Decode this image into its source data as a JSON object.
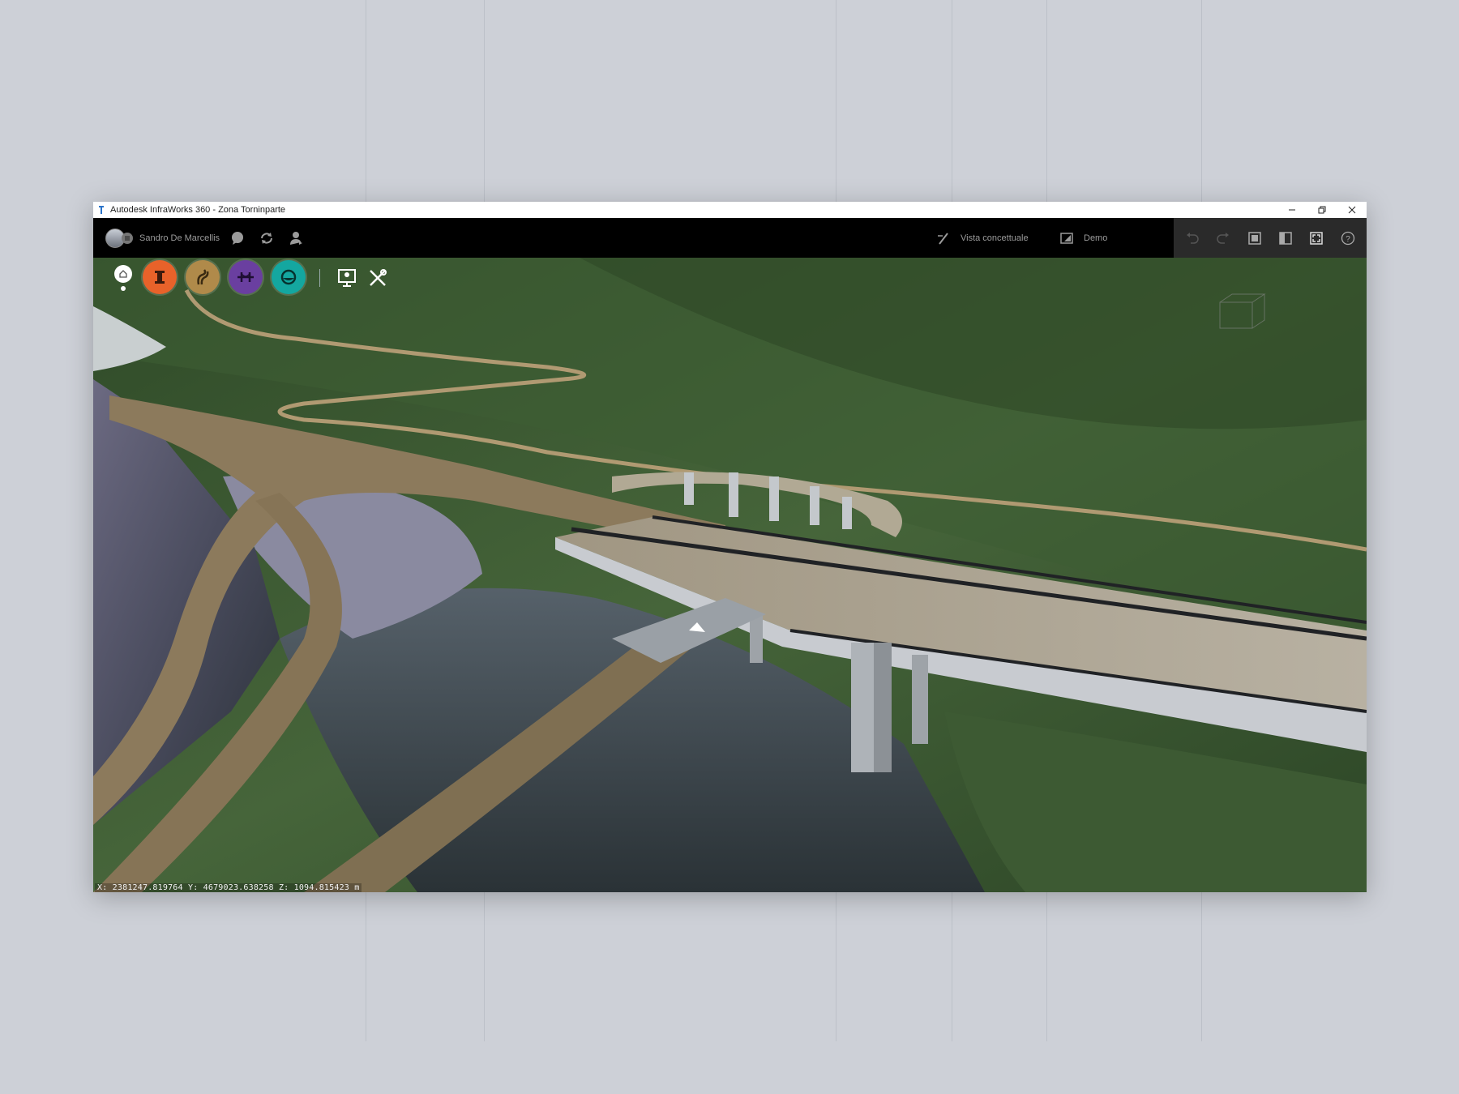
{
  "window": {
    "title": "Autodesk InfraWorks 360 - Zona Torninparte",
    "controls": [
      "minimize",
      "restore",
      "close"
    ]
  },
  "topbar": {
    "user_name": "Sandro De Marcellis",
    "visual_style_label": "Vista concettuale",
    "proposal_label": "Demo",
    "left_icons": [
      "chat-icon",
      "sync-icon",
      "user-share-icon"
    ],
    "right_tools": [
      "undo-icon",
      "redo-icon",
      "window-icon",
      "panel-icon",
      "fullscreen-icon",
      "help-icon"
    ]
  },
  "toolbar": {
    "home_icon": "home-icon",
    "buttons": [
      {
        "name": "create-manage-button",
        "icon": "building-icon",
        "color": "#e8622a"
      },
      {
        "name": "design-roads-button",
        "icon": "road-icon",
        "color": "#b08a4a"
      },
      {
        "name": "design-bridges-button",
        "icon": "bridge-icon",
        "color": "#6a3fa0"
      },
      {
        "name": "drainage-button",
        "icon": "water-icon",
        "color": "#14a7a0"
      }
    ],
    "extra_icons": [
      "present-icon",
      "settings-tools-icon"
    ]
  },
  "status": {
    "coordinates": "X: 2381247.819764 Y: 4679023.638258 Z: 1094.815423 m"
  },
  "colors": {
    "background": "#cdd0d7",
    "topbar": "#000000",
    "forest": "#3c5a30",
    "road": "#8c7a5c",
    "bridge": "#c8cbd0"
  }
}
